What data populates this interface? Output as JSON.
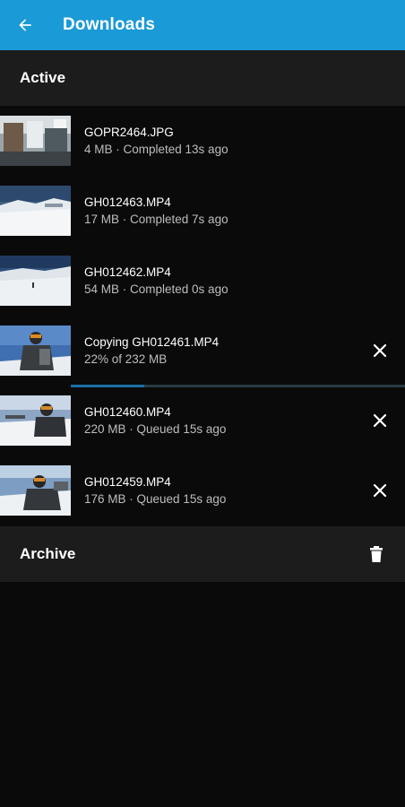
{
  "header": {
    "title": "Downloads",
    "back_icon": "arrow-left-icon",
    "color": "#1a9ad6"
  },
  "active": {
    "title": "Active"
  },
  "items": [
    {
      "name": "GOPR2464.JPG",
      "subtitle": "4 MB · Completed 13s ago",
      "thumb": "indoor"
    },
    {
      "name": "GH012463.MP4",
      "subtitle": "17 MB · Completed 7s ago",
      "thumb": "snow"
    },
    {
      "name": "GH012462.MP4",
      "subtitle": "54 MB · Completed 0s ago",
      "thumb": "snow2"
    },
    {
      "name": "Copying GH012461.MP4",
      "subtitle": "22% of 232 MB",
      "thumb": "skier",
      "cancelable": true,
      "progress": 0.22
    },
    {
      "name": "GH012460.MP4",
      "subtitle": "220 MB · Queued 15s ago",
      "thumb": "skier2",
      "cancelable": true
    },
    {
      "name": "GH012459.MP4",
      "subtitle": "176 MB · Queued 15s ago",
      "thumb": "skier3",
      "cancelable": true
    }
  ],
  "archive": {
    "title": "Archive",
    "icon": "trash-icon"
  }
}
